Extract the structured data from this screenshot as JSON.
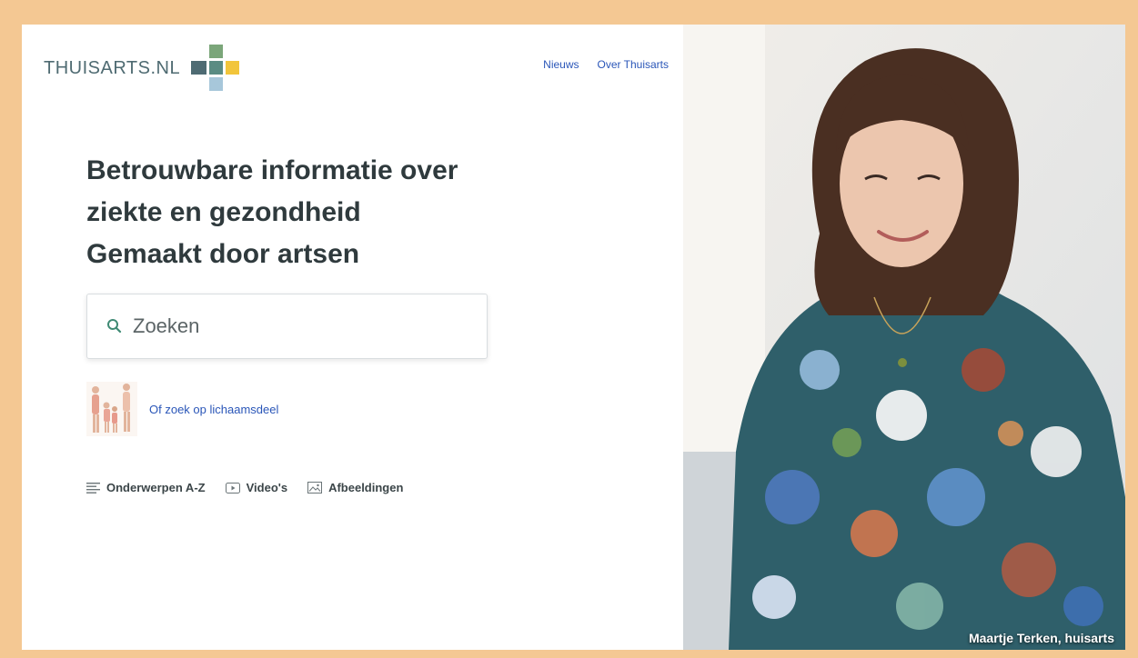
{
  "logo": {
    "text": "THUISARTS.NL",
    "colors": {
      "green": "#7ba67a",
      "slate": "#4e6b73",
      "teal": "#5a8c83",
      "yellow": "#f2c53b",
      "blue": "#a7c7da"
    }
  },
  "nav": {
    "items": [
      {
        "label": "Nieuws"
      },
      {
        "label": "Over Thuisarts"
      }
    ]
  },
  "hero": {
    "line1": "Betrouwbare informatie over",
    "line2": "ziekte en gezondheid",
    "line3": "Gemaakt door artsen"
  },
  "search": {
    "placeholder": "Zoeken",
    "value": ""
  },
  "body_search": {
    "label": "Of zoek op lichaamsdeel"
  },
  "quick_links": [
    {
      "label": "Onderwerpen A-Z",
      "icon": "list-icon"
    },
    {
      "label": "Video's",
      "icon": "play-icon"
    },
    {
      "label": "Afbeeldingen",
      "icon": "image-icon"
    }
  ],
  "photo": {
    "caption": "Maartje Terken, huisarts"
  },
  "colors": {
    "frame": "#f4c893",
    "link": "#2a56b8",
    "heading": "#2f3a3d"
  }
}
